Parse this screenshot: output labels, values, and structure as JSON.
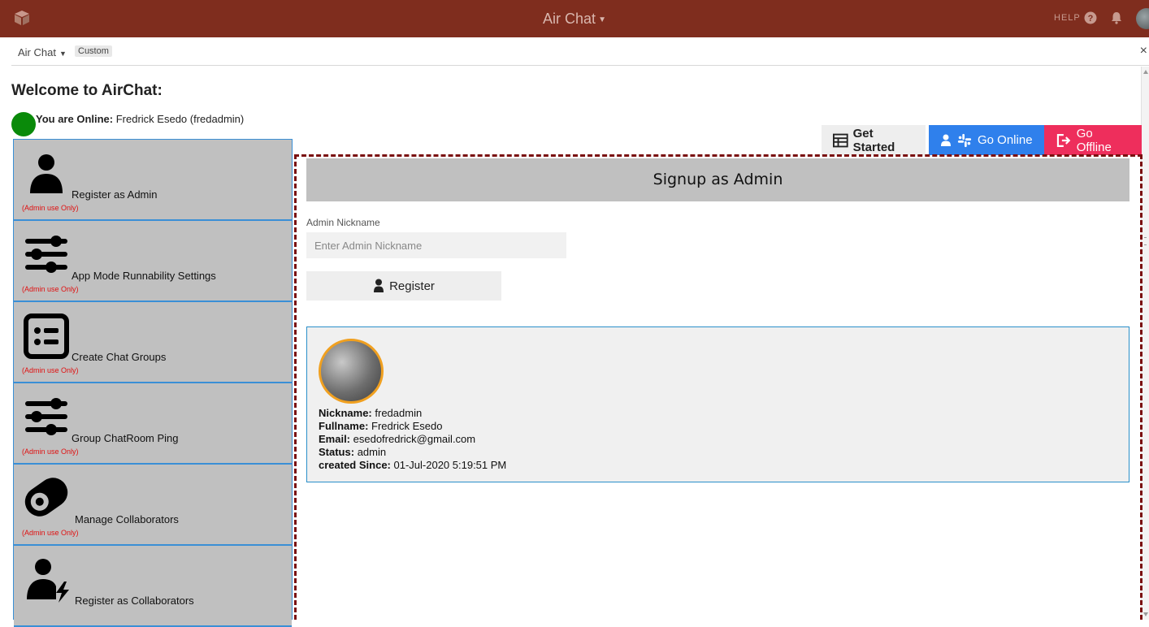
{
  "topbar": {
    "app_title": "Air Chat",
    "help_label": "HELP"
  },
  "window": {
    "menu_name": "Air Chat",
    "tag": "Custom",
    "close": "×"
  },
  "welcome": "Welcome to AirChat:",
  "online": {
    "prefix": "You are Online:",
    "user": "Fredrick Esedo (fredadmin)",
    "dot_color": "#0a8a0a"
  },
  "buttons": {
    "get_started": "Get Started",
    "go_online": "Go Online",
    "go_offline": "Go Offline"
  },
  "sidebar": {
    "items": [
      {
        "label": "Register as Admin",
        "note": "(Admin use Only)",
        "icon": "user-icon"
      },
      {
        "label": "App Mode Runnability Settings",
        "note": "(Admin use Only)",
        "icon": "sliders-icon"
      },
      {
        "label": "Create Chat Groups",
        "note": "(Admin use Only)",
        "icon": "list-icon"
      },
      {
        "label": "Group ChatRoom Ping",
        "note": "(Admin use Only)",
        "icon": "sliders-icon"
      },
      {
        "label": "Manage Collaborators",
        "note": "(Admin use Only)",
        "icon": "toggle-icon"
      },
      {
        "label": "Register as Collaborators",
        "note": "",
        "icon": "user-bolt-icon"
      }
    ]
  },
  "signup": {
    "heading": "Signup as Admin",
    "field_label": "Admin Nickname",
    "placeholder": "Enter Admin Nickname",
    "register": "Register"
  },
  "profile": {
    "nickname_label": "Nickname:",
    "nickname": "fredadmin",
    "fullname_label": "Fullname:",
    "fullname": "Fredrick Esedo",
    "email_label": "Email:",
    "email": "esedofredrick@gmail.com",
    "status_label": "Status:",
    "status": "admin",
    "created_label": "created Since:",
    "created": "01-Jul-2020 5:19:51 PM"
  },
  "colors": {
    "topbar": "#7f2d1e",
    "online_button": "#2f80ec",
    "offline_button": "#ee2e5c",
    "panel_border": "#7a1010",
    "sidebar_border": "#3a8fd6"
  }
}
